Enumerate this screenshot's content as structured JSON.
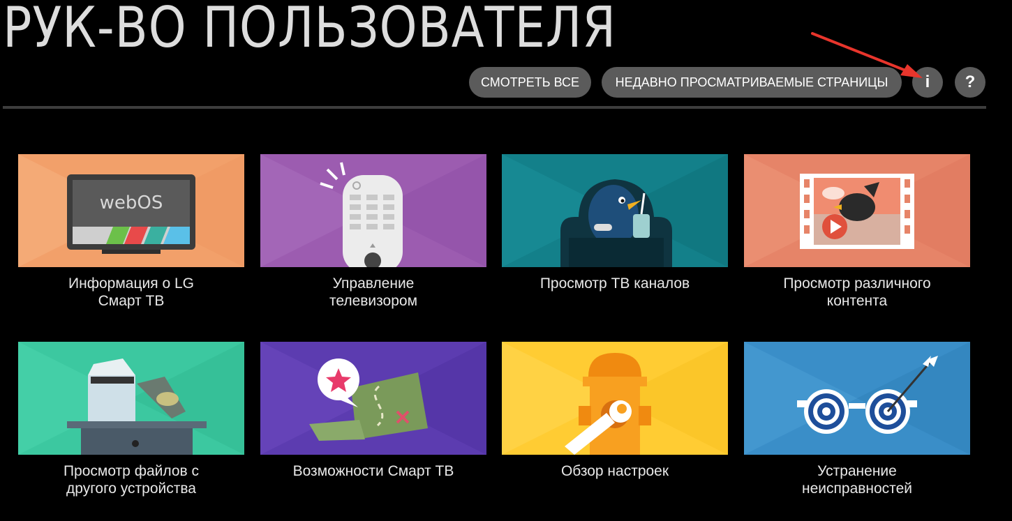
{
  "header": {
    "title": "РУК-ВО ПОЛЬЗОВАТЕЛЯ",
    "view_all_label": "СМОТРЕТЬ ВСЕ",
    "recent_pages_label": "НЕДАВНО ПРОСМАТРИВАЕМЫЕ СТРАНИЦЫ",
    "info_label": "i",
    "help_label": "?"
  },
  "tiles": [
    {
      "line1": "Информация о LG",
      "line2": "Смарт ТВ",
      "icon": "tv-icon",
      "tv_screen_text": "webOS",
      "color": "#f2a06a"
    },
    {
      "line1": "Управление",
      "line2": "телевизором",
      "icon": "remote-control-icon",
      "color": "#9c5cb0"
    },
    {
      "line1": "Просмотр ТВ каналов",
      "line2": "",
      "icon": "penguin-armchair-icon",
      "color": "#13808a"
    },
    {
      "line1": "Просмотр различного",
      "line2": "контента",
      "icon": "film-strip-icon",
      "color": "#e68468"
    },
    {
      "line1": "Просмотр файлов с",
      "line2": "другого устройства",
      "icon": "computer-devices-icon",
      "color": "#3cc8a0"
    },
    {
      "line1": "Возможности Смарт ТВ",
      "line2": "",
      "icon": "map-star-icon",
      "color": "#5c3cb0"
    },
    {
      "line1": "Обзор настроек",
      "line2": "",
      "icon": "hydrant-wrench-icon",
      "color": "#ffcc33"
    },
    {
      "line1": "Устранение",
      "line2": "неисправностей",
      "icon": "target-glasses-icon",
      "color": "#3a8ec8"
    }
  ],
  "colors": {
    "background": "#000000",
    "button": "#5b5b5b",
    "divider": "#3d3d3d",
    "annotation_arrow": "#e8352c"
  }
}
